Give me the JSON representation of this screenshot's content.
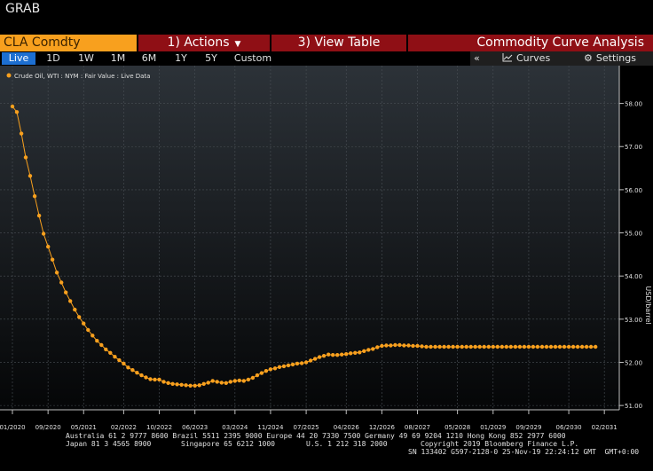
{
  "app": {
    "title": "GRAB"
  },
  "toolbar": {
    "ticker": "CLA Comdty",
    "actions": "1) Actions",
    "view_table": "3) View Table",
    "analysis": "Commodity Curve Analysis"
  },
  "ranges": [
    "Live",
    "1D",
    "1W",
    "1M",
    "6M",
    "1Y",
    "5Y",
    "Custom"
  ],
  "tools": {
    "collapse": "«",
    "curves": "Curves",
    "settings": "Settings"
  },
  "icons": {
    "curves": "chart-line-icon",
    "settings": "gear-icon",
    "caret": "caret-down-icon"
  },
  "colors": {
    "accent": "#f8a01e",
    "toolbar": "#8f0f15",
    "live": "#1d6fd1",
    "background": "#000000"
  },
  "chart_data": {
    "type": "line",
    "legend": "Crude Oil, WTI : NYM : Fair Value : Live Data",
    "ylabel": "USD/barrel",
    "ylim": [
      50.9,
      58.3
    ],
    "yticks": [
      51,
      52,
      53,
      54,
      55,
      56,
      57,
      58
    ],
    "ytick_labels": [
      "51.00",
      "52.00",
      "53.00",
      "54.00",
      "55.00",
      "56.00",
      "57.00",
      "58.00"
    ],
    "x_range": [
      2020.0,
      2031.13
    ],
    "xticks": [
      {
        "label": "01/2020",
        "t": 2020.0
      },
      {
        "label": "09/2020",
        "t": 2020.667
      },
      {
        "label": "05/2021",
        "t": 2021.333
      },
      {
        "label": "02/2022",
        "t": 2022.083
      },
      {
        "label": "10/2022",
        "t": 2022.75
      },
      {
        "label": "06/2023",
        "t": 2023.417
      },
      {
        "label": "03/2024",
        "t": 2024.167
      },
      {
        "label": "11/2024",
        "t": 2024.833
      },
      {
        "label": "07/2025",
        "t": 2025.5
      },
      {
        "label": "04/2026",
        "t": 2026.25
      },
      {
        "label": "12/2026",
        "t": 2026.917
      },
      {
        "label": "08/2027",
        "t": 2027.583
      },
      {
        "label": "05/2028",
        "t": 2028.333
      },
      {
        "label": "01/2029",
        "t": 2029.0
      },
      {
        "label": "09/2029",
        "t": 2029.667
      },
      {
        "label": "06/2030",
        "t": 2030.417
      },
      {
        "label": "02/2031",
        "t": 2031.083
      }
    ],
    "grid": true,
    "series": [
      {
        "color": "#f8a01e",
        "points": [
          [
            2020.0,
            57.93
          ],
          [
            2020.083,
            57.8
          ],
          [
            2020.167,
            57.3
          ],
          [
            2020.25,
            56.75
          ],
          [
            2020.333,
            56.32
          ],
          [
            2020.417,
            55.85
          ],
          [
            2020.5,
            55.4
          ],
          [
            2020.583,
            54.98
          ],
          [
            2020.667,
            54.68
          ],
          [
            2020.75,
            54.38
          ],
          [
            2020.833,
            54.08
          ],
          [
            2020.917,
            53.85
          ],
          [
            2021.0,
            53.62
          ],
          [
            2021.083,
            53.42
          ],
          [
            2021.167,
            53.22
          ],
          [
            2021.25,
            53.05
          ],
          [
            2021.333,
            52.9
          ],
          [
            2021.417,
            52.75
          ],
          [
            2021.5,
            52.62
          ],
          [
            2021.583,
            52.5
          ],
          [
            2021.667,
            52.4
          ],
          [
            2021.75,
            52.3
          ],
          [
            2021.833,
            52.22
          ],
          [
            2021.917,
            52.13
          ],
          [
            2022.0,
            52.05
          ],
          [
            2022.083,
            51.97
          ],
          [
            2022.167,
            51.88
          ],
          [
            2022.25,
            51.82
          ],
          [
            2022.333,
            51.76
          ],
          [
            2022.417,
            51.7
          ],
          [
            2022.5,
            51.65
          ],
          [
            2022.583,
            51.61
          ],
          [
            2022.667,
            51.6
          ],
          [
            2022.75,
            51.6
          ],
          [
            2022.833,
            51.55
          ],
          [
            2022.917,
            51.52
          ],
          [
            2023.0,
            51.5
          ],
          [
            2023.083,
            51.49
          ],
          [
            2023.167,
            51.48
          ],
          [
            2023.25,
            51.47
          ],
          [
            2023.333,
            51.46
          ],
          [
            2023.417,
            51.46
          ],
          [
            2023.5,
            51.47
          ],
          [
            2023.583,
            51.5
          ],
          [
            2023.667,
            51.53
          ],
          [
            2023.75,
            51.57
          ],
          [
            2023.833,
            51.55
          ],
          [
            2023.917,
            51.53
          ],
          [
            2024.0,
            51.52
          ],
          [
            2024.083,
            51.55
          ],
          [
            2024.167,
            51.57
          ],
          [
            2024.25,
            51.58
          ],
          [
            2024.333,
            51.57
          ],
          [
            2024.417,
            51.6
          ],
          [
            2024.5,
            51.64
          ],
          [
            2024.583,
            51.7
          ],
          [
            2024.667,
            51.75
          ],
          [
            2024.75,
            51.8
          ],
          [
            2024.833,
            51.84
          ],
          [
            2024.917,
            51.86
          ],
          [
            2025.0,
            51.89
          ],
          [
            2025.083,
            51.91
          ],
          [
            2025.167,
            51.93
          ],
          [
            2025.25,
            51.95
          ],
          [
            2025.333,
            51.97
          ],
          [
            2025.417,
            51.98
          ],
          [
            2025.5,
            52.0
          ],
          [
            2025.583,
            52.04
          ],
          [
            2025.667,
            52.08
          ],
          [
            2025.75,
            52.12
          ],
          [
            2025.833,
            52.15
          ],
          [
            2025.917,
            52.18
          ],
          [
            2026.0,
            52.17
          ],
          [
            2026.083,
            52.17
          ],
          [
            2026.167,
            52.18
          ],
          [
            2026.25,
            52.19
          ],
          [
            2026.333,
            52.21
          ],
          [
            2026.417,
            52.22
          ],
          [
            2026.5,
            52.23
          ],
          [
            2026.583,
            52.26
          ],
          [
            2026.667,
            52.29
          ],
          [
            2026.75,
            52.31
          ],
          [
            2026.833,
            52.35
          ],
          [
            2026.917,
            52.38
          ],
          [
            2027.0,
            52.39
          ],
          [
            2027.083,
            52.39
          ],
          [
            2027.167,
            52.4
          ],
          [
            2027.25,
            52.4
          ],
          [
            2027.333,
            52.39
          ],
          [
            2027.417,
            52.39
          ],
          [
            2027.5,
            52.38
          ],
          [
            2027.583,
            52.38
          ],
          [
            2027.667,
            52.37
          ],
          [
            2027.75,
            52.36
          ],
          [
            2027.833,
            52.36
          ],
          [
            2027.917,
            52.36
          ],
          [
            2028.0,
            52.36
          ],
          [
            2028.083,
            52.36
          ],
          [
            2028.167,
            52.36
          ],
          [
            2028.25,
            52.36
          ],
          [
            2028.333,
            52.36
          ],
          [
            2028.417,
            52.36
          ],
          [
            2028.5,
            52.36
          ],
          [
            2028.583,
            52.36
          ],
          [
            2028.667,
            52.36
          ],
          [
            2028.75,
            52.36
          ],
          [
            2028.833,
            52.36
          ],
          [
            2028.917,
            52.36
          ],
          [
            2029.0,
            52.36
          ],
          [
            2029.083,
            52.36
          ],
          [
            2029.167,
            52.36
          ],
          [
            2029.25,
            52.36
          ],
          [
            2029.333,
            52.36
          ],
          [
            2029.417,
            52.36
          ],
          [
            2029.5,
            52.36
          ],
          [
            2029.583,
            52.36
          ],
          [
            2029.667,
            52.36
          ],
          [
            2029.75,
            52.36
          ],
          [
            2029.833,
            52.36
          ],
          [
            2029.917,
            52.36
          ],
          [
            2030.0,
            52.36
          ],
          [
            2030.083,
            52.36
          ],
          [
            2030.167,
            52.36
          ],
          [
            2030.25,
            52.36
          ],
          [
            2030.333,
            52.36
          ],
          [
            2030.417,
            52.36
          ],
          [
            2030.5,
            52.36
          ],
          [
            2030.583,
            52.36
          ],
          [
            2030.667,
            52.36
          ],
          [
            2030.75,
            52.36
          ],
          [
            2030.833,
            52.36
          ],
          [
            2030.917,
            52.36
          ]
        ]
      }
    ]
  },
  "footer": {
    "line1": "Australia 61 2 9777 8600 Brazil 5511 2395 9000 Europe 44 20 7330 7500 Germany 49 69 9204 1210 Hong Kong 852 2977 6000",
    "line2a": "Japan 81 3 4565 8900",
    "line2b": "Singapore 65 6212 1000",
    "line2c": "U.S. 1 212 318 2000",
    "line2d": "Copyright 2019 Bloomberg Finance L.P.",
    "line3": "SN 133402 G597-2128-0 25-Nov-19 22:24:12 GMT  GMT+0:00"
  }
}
